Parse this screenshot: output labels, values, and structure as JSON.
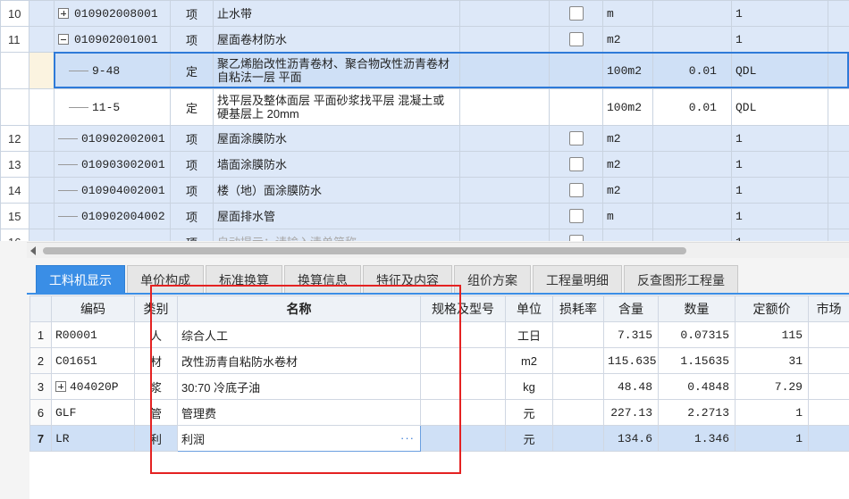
{
  "top_rows": [
    {
      "index": "10",
      "tree": "plus",
      "code": "010902008001",
      "type": "项",
      "name": "止水带",
      "checkbox": true,
      "unit": "m",
      "qty": "",
      "expr": "1",
      "kind": "qd"
    },
    {
      "index": "11",
      "tree": "minus",
      "code": "010902001001",
      "type": "项",
      "name": "屋面卷材防水",
      "checkbox": true,
      "unit": "m2",
      "qty": "",
      "expr": "1",
      "kind": "qd"
    },
    {
      "index": "",
      "tree": "line-deep",
      "code": "9-48",
      "type": "定",
      "name": "聚乙烯胎改性沥青卷材、聚合物改性沥青卷材 自粘法一层 平面",
      "checkbox": false,
      "unit": "100m2",
      "qty": "0.01",
      "expr": "QDL",
      "kind": "sel"
    },
    {
      "index": "",
      "tree": "line-deep",
      "code": "11-5",
      "type": "定",
      "name": "找平层及整体面层 平面砂浆找平层 混凝土或硬基层上 20mm",
      "checkbox": false,
      "unit": "100m2",
      "qty": "0.01",
      "expr": "QDL",
      "kind": "sub"
    },
    {
      "index": "12",
      "tree": "line",
      "code": "010902002001",
      "type": "项",
      "name": "屋面涂膜防水",
      "checkbox": true,
      "unit": "m2",
      "qty": "",
      "expr": "1",
      "kind": "qd"
    },
    {
      "index": "13",
      "tree": "line",
      "code": "010903002001",
      "type": "项",
      "name": "墙面涂膜防水",
      "checkbox": true,
      "unit": "m2",
      "qty": "",
      "expr": "1",
      "kind": "qd"
    },
    {
      "index": "14",
      "tree": "line",
      "code": "010904002001",
      "type": "项",
      "name": "楼（地）面涂膜防水",
      "checkbox": true,
      "unit": "m2",
      "qty": "",
      "expr": "1",
      "kind": "qd"
    },
    {
      "index": "15",
      "tree": "line",
      "code": "010902004002",
      "type": "项",
      "name": "屋面排水管",
      "checkbox": true,
      "unit": "m",
      "qty": "",
      "expr": "1",
      "kind": "qd"
    },
    {
      "index": "16",
      "tree": "line",
      "code": "",
      "type": "项",
      "name": "自动提示：请输入清单简称",
      "checkbox": true,
      "unit": "",
      "qty": "",
      "expr": "1",
      "kind": "qd"
    }
  ],
  "tabs": [
    {
      "label": "工料机显示",
      "active": true
    },
    {
      "label": "单价构成",
      "active": false
    },
    {
      "label": "标准换算",
      "active": false
    },
    {
      "label": "换算信息",
      "active": false
    },
    {
      "label": "特征及内容",
      "active": false
    },
    {
      "label": "组价方案",
      "active": false
    },
    {
      "label": "工程量明细",
      "active": false
    },
    {
      "label": "反查图形工程量",
      "active": false
    }
  ],
  "bottom_headers": [
    "编码",
    "类别",
    "名称",
    "规格及型号",
    "单位",
    "损耗率",
    "含量",
    "数量",
    "定额价",
    "市场"
  ],
  "bottom_rows": [
    {
      "no": "1",
      "code": "R00001",
      "cat": "人",
      "name": "综合人工",
      "spec": "",
      "unit": "工日",
      "loss": "",
      "content": "7.315",
      "qty": "0.07315",
      "price": "115",
      "expandable": false,
      "selected": false
    },
    {
      "no": "2",
      "code": "C01651",
      "cat": "材",
      "name": "改性沥青自粘防水卷材",
      "spec": "",
      "unit": "m2",
      "loss": "",
      "content": "115.635",
      "qty": "1.15635",
      "price": "31",
      "expandable": false,
      "selected": false
    },
    {
      "no": "3",
      "code": "404020P",
      "cat": "浆",
      "name": "30:70 冷底子油",
      "spec": "",
      "unit": "kg",
      "loss": "",
      "content": "48.48",
      "qty": "0.4848",
      "price": "7.29",
      "expandable": true,
      "selected": false
    },
    {
      "no": "6",
      "code": "GLF",
      "cat": "管",
      "name": "管理费",
      "spec": "",
      "unit": "元",
      "loss": "",
      "content": "227.13",
      "qty": "2.2713",
      "price": "1",
      "expandable": false,
      "selected": false
    },
    {
      "no": "7",
      "code": "LR",
      "cat": "利",
      "name": "利润",
      "spec": "",
      "unit": "元",
      "loss": "",
      "content": "134.6",
      "qty": "1.346",
      "price": "1",
      "expandable": false,
      "selected": true
    }
  ],
  "ellipsis_label": "···"
}
